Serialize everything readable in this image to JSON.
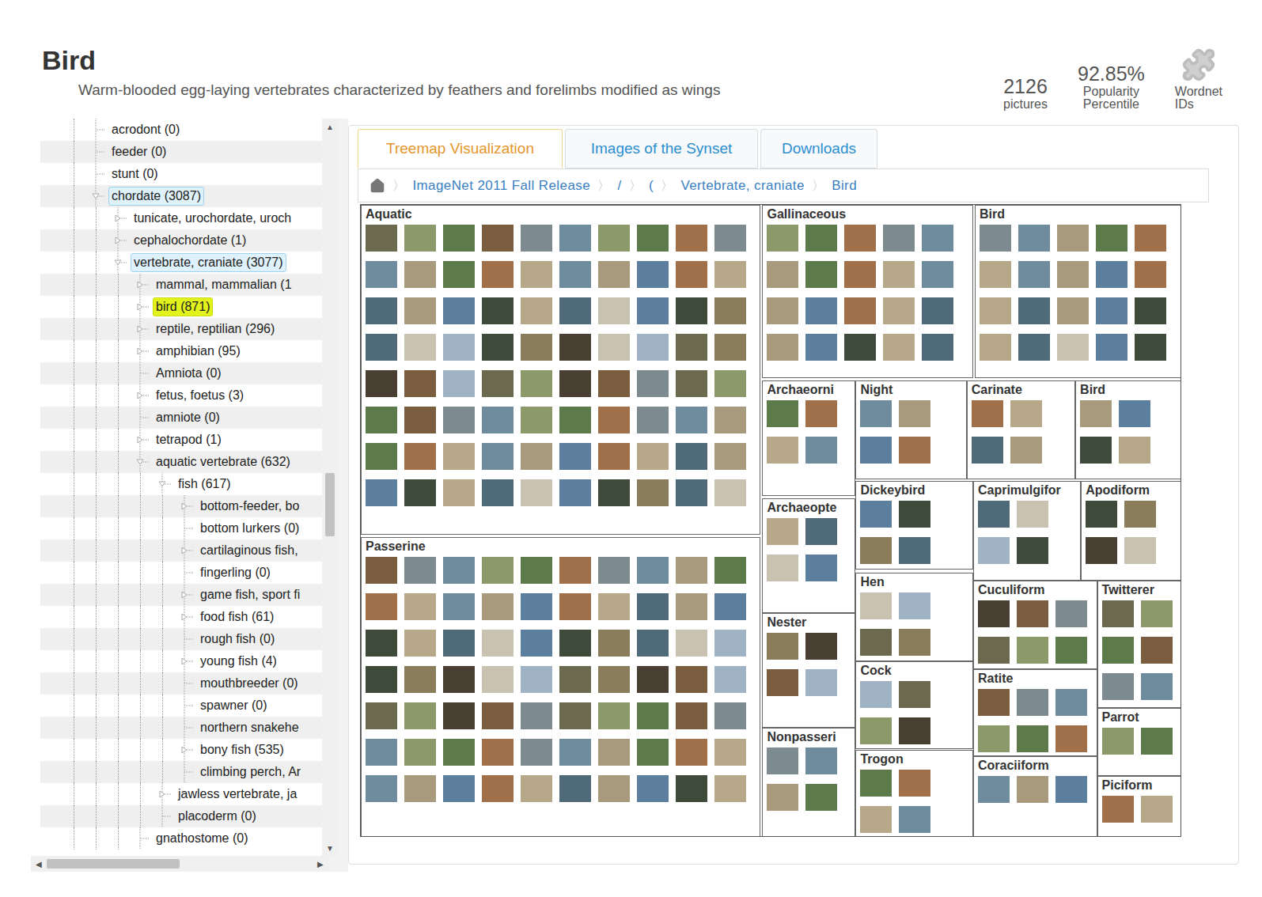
{
  "page": {
    "title": "Bird",
    "description": "Warm-blooded egg-laying vertebrates characterized by feathers and forelimbs modified as wings"
  },
  "stats": [
    {
      "kind": "number",
      "value": "2126",
      "label": [
        "pictures"
      ]
    },
    {
      "kind": "number",
      "value": "92.85%",
      "label": [
        "Popularity",
        "Percentile"
      ]
    },
    {
      "kind": "icon",
      "value": "",
      "label": [
        "Wordnet",
        "IDs"
      ]
    }
  ],
  "tree": {
    "items": [
      {
        "label": "acrodont (0)",
        "level": 2,
        "kind": "leaf",
        "expanded": false,
        "in_path": false,
        "selected": false
      },
      {
        "label": "feeder (0)",
        "level": 2,
        "kind": "leaf",
        "expanded": false,
        "in_path": false,
        "selected": false
      },
      {
        "label": "stunt (0)",
        "level": 2,
        "kind": "leaf",
        "expanded": false,
        "in_path": false,
        "selected": false
      },
      {
        "label": "chordate (3087)",
        "level": 2,
        "kind": "branch",
        "expanded": true,
        "in_path": true,
        "selected": false
      },
      {
        "label": "tunicate, urochordate, uroch",
        "level": 3,
        "kind": "branch",
        "expanded": false,
        "in_path": false,
        "selected": false
      },
      {
        "label": "cephalochordate (1)",
        "level": 3,
        "kind": "branch",
        "expanded": false,
        "in_path": false,
        "selected": false
      },
      {
        "label": "vertebrate, craniate (3077)",
        "level": 3,
        "kind": "branch",
        "expanded": true,
        "in_path": true,
        "selected": false
      },
      {
        "label": "mammal, mammalian (1",
        "level": 4,
        "kind": "branch",
        "expanded": false,
        "in_path": false,
        "selected": false
      },
      {
        "label": "bird (871)",
        "level": 4,
        "kind": "branch",
        "expanded": false,
        "in_path": false,
        "selected": true
      },
      {
        "label": "reptile, reptilian (296)",
        "level": 4,
        "kind": "branch",
        "expanded": false,
        "in_path": false,
        "selected": false
      },
      {
        "label": "amphibian (95)",
        "level": 4,
        "kind": "branch",
        "expanded": false,
        "in_path": false,
        "selected": false
      },
      {
        "label": "Amniota (0)",
        "level": 4,
        "kind": "leaf",
        "expanded": false,
        "in_path": false,
        "selected": false
      },
      {
        "label": "fetus, foetus (3)",
        "level": 4,
        "kind": "branch",
        "expanded": false,
        "in_path": false,
        "selected": false
      },
      {
        "label": "amniote (0)",
        "level": 4,
        "kind": "leaf",
        "expanded": false,
        "in_path": false,
        "selected": false
      },
      {
        "label": "tetrapod (1)",
        "level": 4,
        "kind": "branch",
        "expanded": false,
        "in_path": false,
        "selected": false
      },
      {
        "label": "aquatic vertebrate (632)",
        "level": 4,
        "kind": "branch",
        "expanded": true,
        "in_path": false,
        "selected": false
      },
      {
        "label": "fish (617)",
        "level": 5,
        "kind": "branch",
        "expanded": true,
        "in_path": false,
        "selected": false
      },
      {
        "label": "bottom-feeder, bo",
        "level": 6,
        "kind": "branch",
        "expanded": false,
        "in_path": false,
        "selected": false
      },
      {
        "label": "bottom lurkers (0)",
        "level": 6,
        "kind": "leaf",
        "expanded": false,
        "in_path": false,
        "selected": false
      },
      {
        "label": "cartilaginous fish,",
        "level": 6,
        "kind": "branch",
        "expanded": false,
        "in_path": false,
        "selected": false
      },
      {
        "label": "fingerling (0)",
        "level": 6,
        "kind": "leaf",
        "expanded": false,
        "in_path": false,
        "selected": false
      },
      {
        "label": "game fish, sport fi",
        "level": 6,
        "kind": "branch",
        "expanded": false,
        "in_path": false,
        "selected": false
      },
      {
        "label": "food fish (61)",
        "level": 6,
        "kind": "branch",
        "expanded": false,
        "in_path": false,
        "selected": false
      },
      {
        "label": "rough fish (0)",
        "level": 6,
        "kind": "leaf",
        "expanded": false,
        "in_path": false,
        "selected": false
      },
      {
        "label": "young fish (4)",
        "level": 6,
        "kind": "branch",
        "expanded": false,
        "in_path": false,
        "selected": false
      },
      {
        "label": "mouthbreeder (0)",
        "level": 6,
        "kind": "leaf",
        "expanded": false,
        "in_path": false,
        "selected": false
      },
      {
        "label": "spawner (0)",
        "level": 6,
        "kind": "leaf",
        "expanded": false,
        "in_path": false,
        "selected": false
      },
      {
        "label": "northern snakehe",
        "level": 6,
        "kind": "leaf",
        "expanded": false,
        "in_path": false,
        "selected": false
      },
      {
        "label": "bony fish (535)",
        "level": 6,
        "kind": "branch",
        "expanded": false,
        "in_path": false,
        "selected": false
      },
      {
        "label": "climbing perch, Ar",
        "level": 6,
        "kind": "leaf",
        "expanded": false,
        "in_path": false,
        "selected": false
      },
      {
        "label": "jawless vertebrate, ja",
        "level": 5,
        "kind": "branch",
        "expanded": false,
        "in_path": false,
        "selected": false
      },
      {
        "label": "placoderm (0)",
        "level": 5,
        "kind": "leaf",
        "expanded": false,
        "in_path": false,
        "selected": false
      },
      {
        "label": "gnathostome (0)",
        "level": 4,
        "kind": "leaf",
        "expanded": false,
        "in_path": false,
        "selected": false
      }
    ],
    "vertical_scrollbar": {
      "up": "▲",
      "down": "▼",
      "level": 0.48,
      "size": 0.09
    },
    "horizontal_scrollbar": {
      "left": "◀",
      "right": "▶",
      "level": 0.0,
      "size": 0.5
    }
  },
  "tabs": [
    {
      "label": "Treemap Visualization",
      "selected": true
    },
    {
      "label": "Images of the Synset",
      "selected": false
    },
    {
      "label": "Downloads",
      "selected": false
    }
  ],
  "breadcrumb": {
    "separator": "〉",
    "items": [
      "ImageNet 2011 Fall Release",
      "/",
      "(",
      "Vertebrate, craniate",
      "Bird"
    ]
  },
  "treemap": {
    "cells": [
      {
        "label": "Aquatic"
      },
      {
        "label": "Passerine"
      },
      {
        "label": "Gallinaceous"
      },
      {
        "label": "Bird"
      },
      {
        "label": "Archaeorni"
      },
      {
        "label": "Night"
      },
      {
        "label": "Carinate"
      },
      {
        "label": "Bird"
      },
      {
        "label": "Archaeopte"
      },
      {
        "label": "Dickeybird"
      },
      {
        "label": "Caprimulgifor"
      },
      {
        "label": "Apodiform"
      },
      {
        "label": "Hen"
      },
      {
        "label": "Nester"
      },
      {
        "label": "Cock"
      },
      {
        "label": "Cuculiform"
      },
      {
        "label": "Twitterer"
      },
      {
        "label": "Ratite"
      },
      {
        "label": "Parrot"
      },
      {
        "label": "Nonpasseri"
      },
      {
        "label": "Trogon"
      },
      {
        "label": "Coraciiform"
      },
      {
        "label": "Piciform"
      }
    ]
  }
}
